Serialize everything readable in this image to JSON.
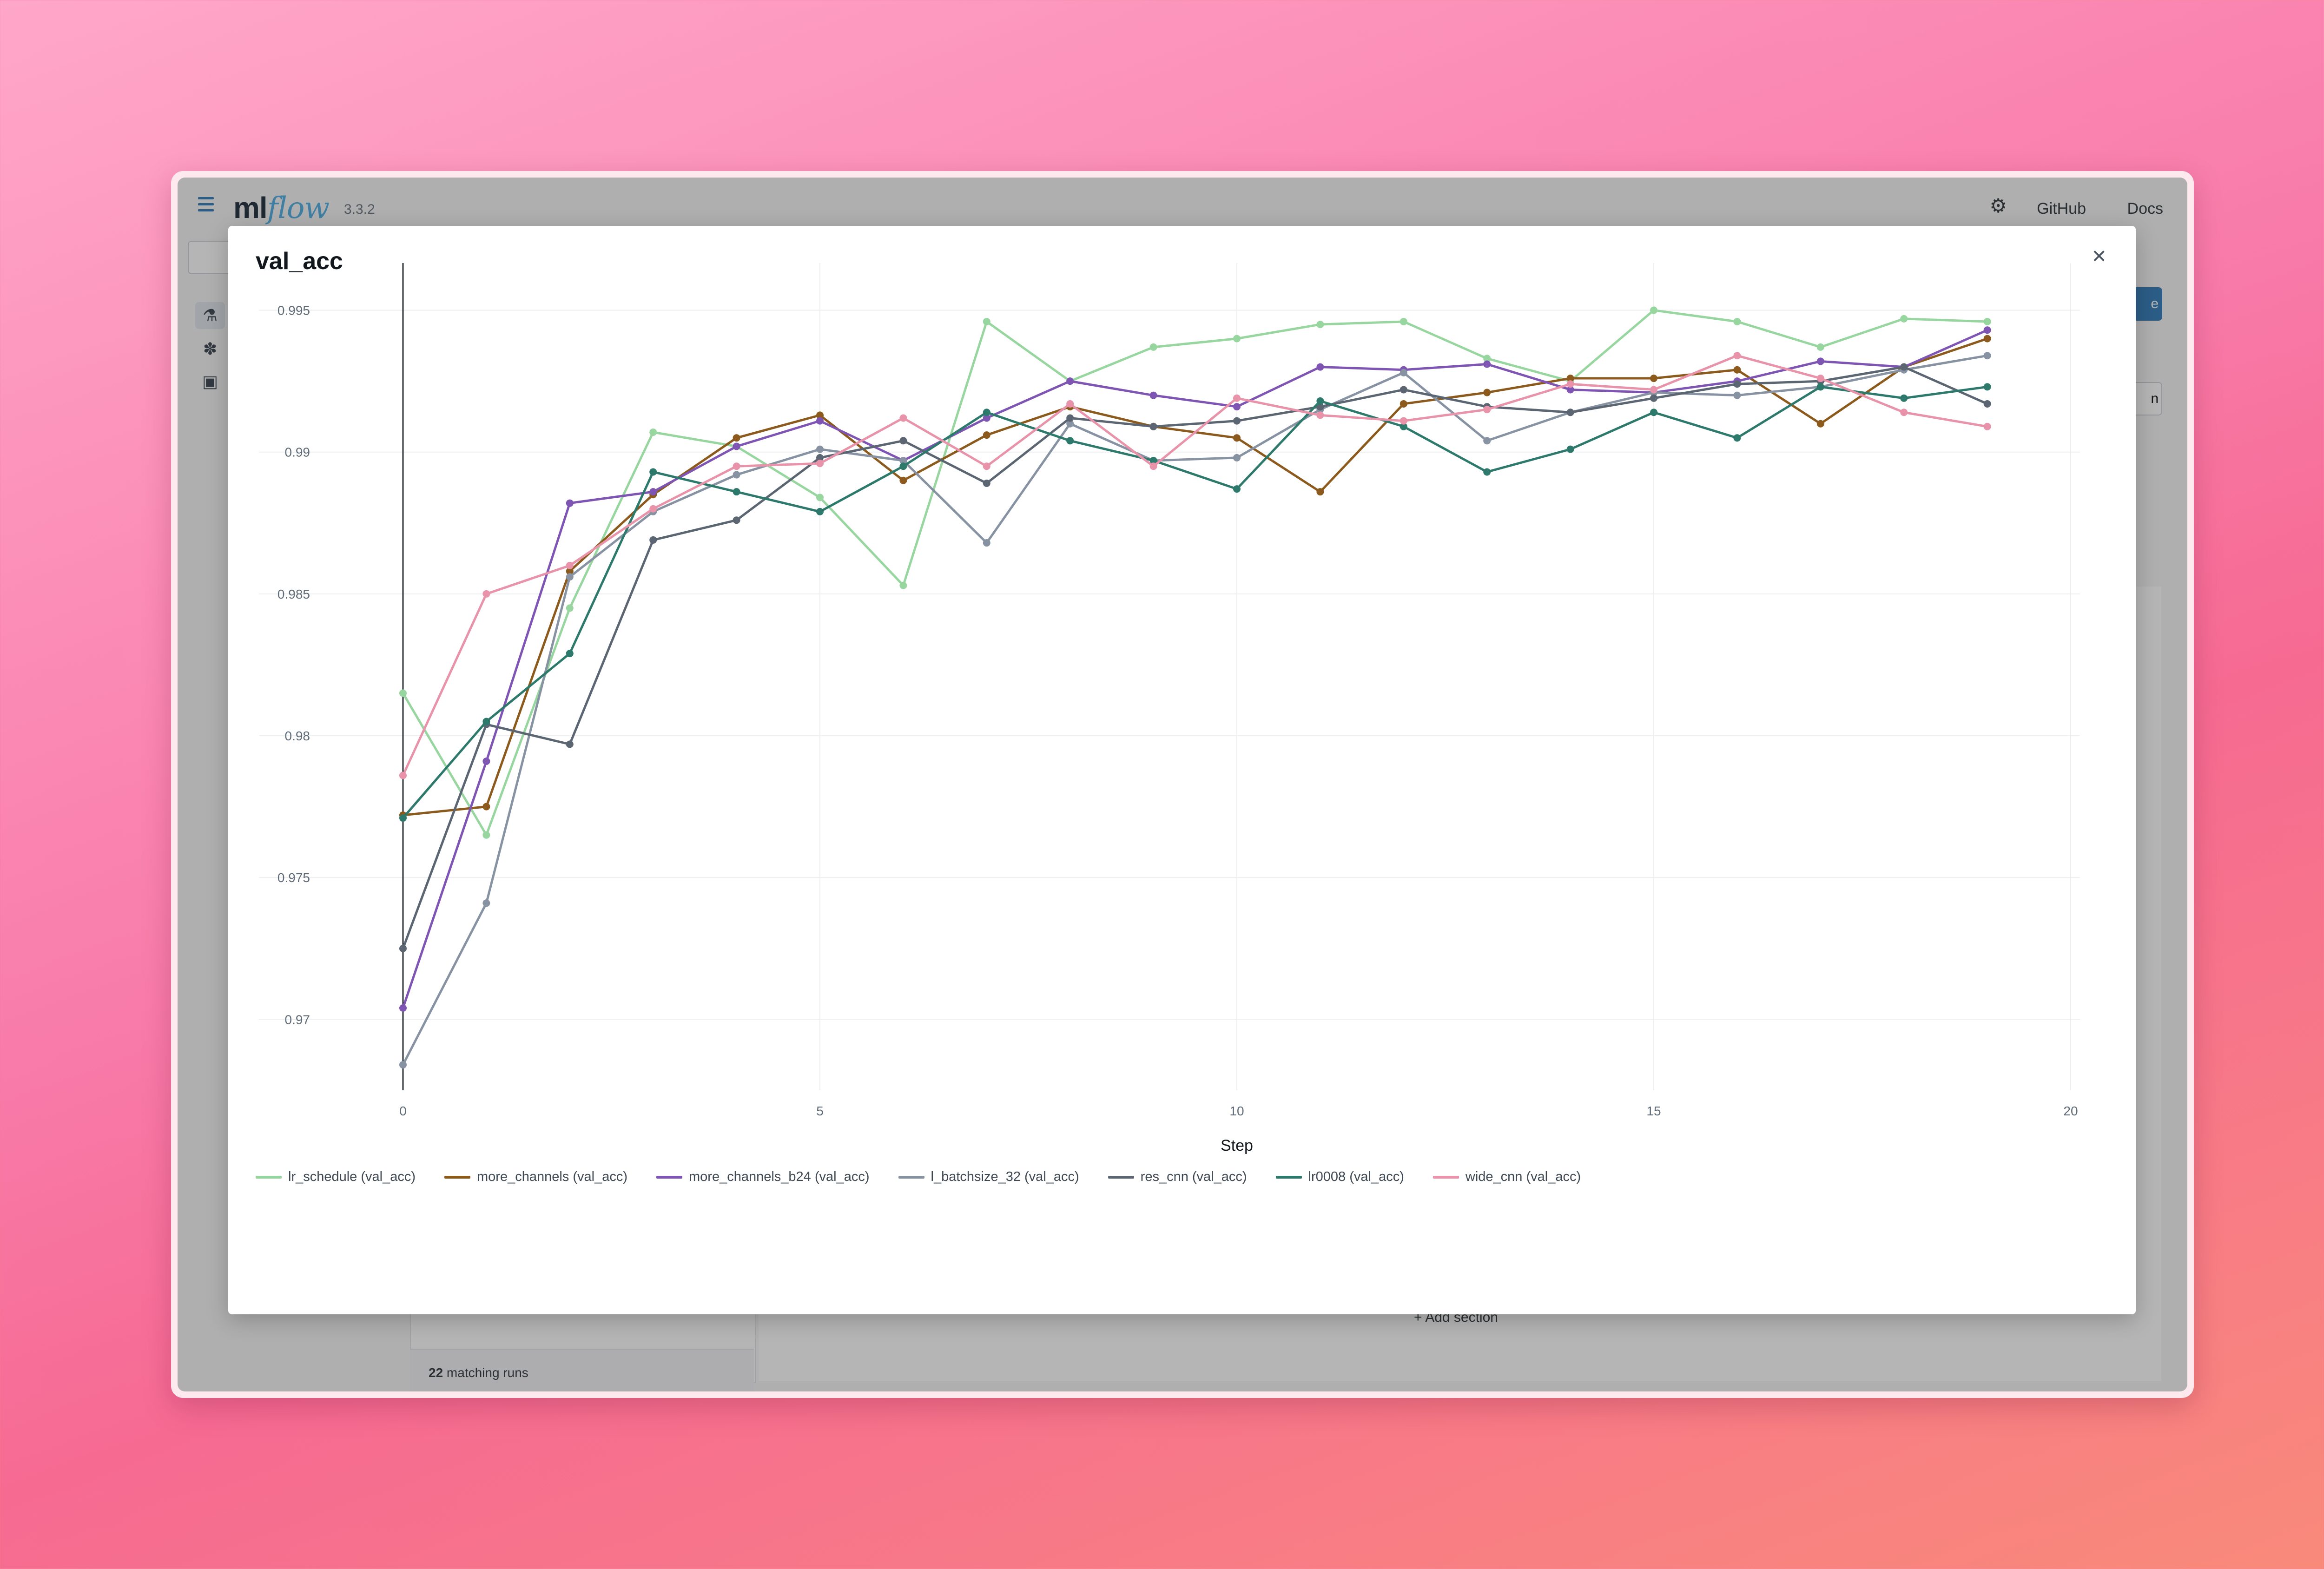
{
  "app": {
    "logo_ml": "ml",
    "logo_flow": "flow",
    "version": "3.3.2",
    "links": [
      "GitHub",
      "Docs"
    ]
  },
  "background": {
    "matching_count": "22",
    "matching_label": " matching runs",
    "add_section": "+ Add section",
    "btn_fragment": "e",
    "btn2_fragment": "n"
  },
  "modal": {
    "title": "val_acc",
    "close_label": "×"
  },
  "chart_data": {
    "type": "line",
    "title": "val_acc",
    "xlabel": "Step",
    "ylabel": "",
    "xlim": [
      0,
      20
    ],
    "ylim": [
      0.9675,
      0.9965
    ],
    "xticks": [
      0,
      5,
      10,
      15,
      20
    ],
    "yticks": [
      0.97,
      0.975,
      0.98,
      0.985,
      0.99,
      0.995
    ],
    "ytick_labels": [
      "0.97",
      "0.975",
      "0.98",
      "0.985",
      "0.99",
      "0.995"
    ],
    "grid": true,
    "legend_position": "bottom",
    "x": [
      0,
      1,
      2,
      3,
      4,
      5,
      6,
      7,
      8,
      9,
      10,
      11,
      12,
      13,
      14,
      15,
      16,
      17,
      18,
      19
    ],
    "series": [
      {
        "name": "lr_schedule (val_acc)",
        "color": "#98d69f",
        "values": [
          0.9815,
          0.9765,
          0.9845,
          0.9907,
          0.9902,
          0.9884,
          0.9853,
          0.9946,
          0.9925,
          0.9937,
          0.994,
          0.9945,
          0.9946,
          0.9933,
          0.9925,
          0.995,
          0.9946,
          0.9937,
          0.9947,
          0.9946
        ]
      },
      {
        "name": "more_channels (val_acc)",
        "color": "#8b5a1c",
        "values": [
          0.9772,
          0.9775,
          0.9858,
          0.9885,
          0.9905,
          0.9913,
          0.989,
          0.9906,
          0.9916,
          0.9909,
          0.9905,
          0.9886,
          0.9917,
          0.9921,
          0.9926,
          0.9926,
          0.9929,
          0.991,
          0.993,
          0.994
        ]
      },
      {
        "name": "more_channels_b24 (val_acc)",
        "color": "#7f55b4",
        "values": [
          0.9704,
          0.9791,
          0.9882,
          0.9886,
          0.9902,
          0.9911,
          0.9897,
          0.9912,
          0.9925,
          0.992,
          0.9916,
          0.993,
          0.9929,
          0.9931,
          0.9922,
          0.9921,
          0.9925,
          0.9932,
          0.993,
          0.9943
        ]
      },
      {
        "name": "l_batchsize_32 (val_acc)",
        "color": "#8793a2",
        "values": [
          0.9684,
          0.9741,
          0.9856,
          0.9879,
          0.9892,
          0.9901,
          0.9897,
          0.9868,
          0.991,
          0.9897,
          0.9898,
          0.9915,
          0.9928,
          0.9904,
          0.9914,
          0.9921,
          0.992,
          0.9923,
          0.9929,
          0.9934
        ]
      },
      {
        "name": "res_cnn (val_acc)",
        "color": "#5b6672",
        "values": [
          0.9725,
          0.9804,
          0.9797,
          0.9869,
          0.9876,
          0.9898,
          0.9904,
          0.9889,
          0.9912,
          0.9909,
          0.9911,
          0.9916,
          0.9922,
          0.9916,
          0.9914,
          0.9919,
          0.9924,
          0.9925,
          0.993,
          0.9917
        ]
      },
      {
        "name": "lr0008 (val_acc)",
        "color": "#2d7a6c",
        "values": [
          0.9771,
          0.9805,
          0.9829,
          0.9893,
          0.9886,
          0.9879,
          0.9895,
          0.9914,
          0.9904,
          0.9897,
          0.9887,
          0.9918,
          0.9909,
          0.9893,
          0.9901,
          0.9914,
          0.9905,
          0.9923,
          0.9919,
          0.9923
        ]
      },
      {
        "name": "wide_cnn (val_acc)",
        "color": "#e893aa",
        "values": [
          0.9786,
          0.985,
          0.986,
          0.988,
          0.9895,
          0.9896,
          0.9912,
          0.9895,
          0.9917,
          0.9895,
          0.9919,
          0.9913,
          0.9911,
          0.9915,
          0.9924,
          0.9922,
          0.9934,
          0.9926,
          0.9914,
          0.9909
        ]
      }
    ]
  }
}
